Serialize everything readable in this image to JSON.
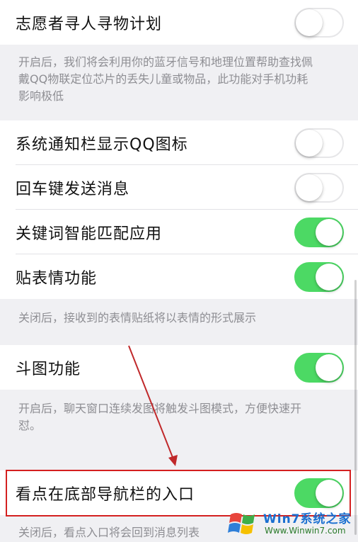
{
  "settings": [
    {
      "label": "志愿者寻人寻物计划",
      "on": false
    },
    {
      "label": "系统通知栏显示QQ图标",
      "on": false
    },
    {
      "label": "回车键发送消息",
      "on": false
    },
    {
      "label": "关键词智能匹配应用",
      "on": true
    },
    {
      "label": "贴表情功能",
      "on": true
    },
    {
      "label": "斗图功能",
      "on": true
    },
    {
      "label": "看点在底部导航栏的入口",
      "on": true
    }
  ],
  "descriptions": {
    "volunteer": "开启后，我们将会利用你的蓝牙信号和地理位置帮助查找佩戴QQ物联定位芯片的丢失儿童或物品，此功能对手机功耗影响极低",
    "sticker": "关闭后，接收到的表情贴纸将以表情的形式展示",
    "doutu": "开启后，聊天窗口连续发图将触发斗图模式，方便快速开怼。",
    "kandian": "关闭后，看点入口将会回到消息列表"
  },
  "watermark": {
    "title": "Win7系统之家",
    "url": "Www.Winwin7.com"
  },
  "colors": {
    "switch_on": "#4cd964",
    "highlight": "#d42020",
    "page_bg": "#f0f0f3"
  }
}
